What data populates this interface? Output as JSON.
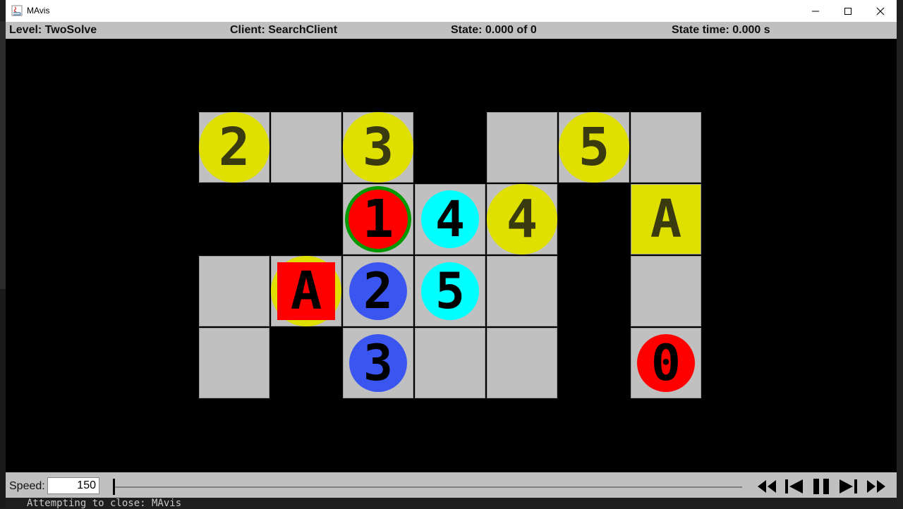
{
  "window": {
    "title": "MAvis"
  },
  "status": {
    "level": "Level: TwoSolve",
    "client": "Client: SearchClient",
    "state": "State: 0.000 of 0",
    "state_time": "State time: 0.000 s"
  },
  "colors": {
    "floor": "#c0c0c0",
    "wall": "#000000",
    "yellow": "#e0e000",
    "red": "#ff0000",
    "blue": "#3b55f0",
    "cyan": "#00ffff",
    "green": "#009900",
    "dark_text": "#3a3a10"
  },
  "goals": [
    {
      "label": "2",
      "color": "yellow"
    },
    {
      "label": "3",
      "color": "yellow"
    },
    {
      "label": "5",
      "color": "yellow"
    },
    {
      "label": "4",
      "color": "yellow"
    },
    {
      "label": "A",
      "color": "yellow"
    },
    {
      "label": "1",
      "color": "green"
    }
  ],
  "agents": [
    {
      "label": "1",
      "color": "red"
    },
    {
      "label": "4",
      "color": "cyan"
    },
    {
      "label": "2",
      "color": "blue"
    },
    {
      "label": "5",
      "color": "cyan"
    },
    {
      "label": "3",
      "color": "blue"
    },
    {
      "label": "0",
      "color": "red"
    }
  ],
  "boxes": [
    {
      "label": "A",
      "color": "red"
    }
  ],
  "controls": {
    "speed_label": "Speed:",
    "speed_value": "150",
    "buttons": [
      "skip-to-start-icon",
      "step-back-icon",
      "pause-icon",
      "step-forward-icon",
      "skip-to-end-icon"
    ]
  },
  "console": {
    "line": "Attempting to close: MAvis"
  }
}
